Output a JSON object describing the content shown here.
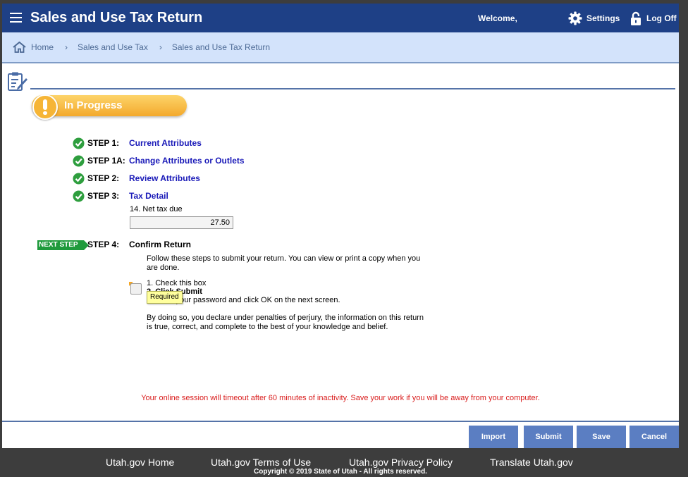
{
  "header": {
    "title": "Sales and Use Tax Return",
    "welcome": "Welcome,",
    "settings_label": "Settings",
    "logoff_label": "Log Off"
  },
  "breadcrumb": [
    "Home",
    "Sales and Use Tax",
    "Sales and Use Tax Return"
  ],
  "status": "In Progress",
  "steps": [
    {
      "label": "STEP 1:",
      "title": "Current Attributes"
    },
    {
      "label": "STEP 1A:",
      "title": "Change Attributes or Outlets"
    },
    {
      "label": "STEP 2:",
      "title": "Review Attributes"
    },
    {
      "label": "STEP 3:",
      "title": "Tax Detail"
    }
  ],
  "net_tax": {
    "label": "14. Net tax due",
    "value": "27.50"
  },
  "next_step": {
    "badge": "NEXT STEP",
    "label": "STEP 4:",
    "title": "Confirm Return",
    "intro": "Follow these steps to submit your return. You can view or print a copy when you are done.",
    "instruction_1": "1. Check this box",
    "instruction_2": "2. Click Submit",
    "instruction_3": "3. Enter your password and click OK on the next screen.",
    "declaration": "By doing so, you declare under penalties of perjury, the information on this return is true, correct, and complete to the best of your knowledge and belief.",
    "required_tooltip": "Required"
  },
  "timeout_notice": "Your online session will timeout after 60 minutes of inactivity. Save your work if you will be away from your computer.",
  "buttons": {
    "import": "Import",
    "submit": "Submit",
    "save": "Save",
    "cancel": "Cancel"
  },
  "footer": {
    "links": [
      "Utah.gov Home",
      "Utah.gov Terms of Use",
      "Utah.gov Privacy Policy",
      "Translate Utah.gov"
    ],
    "copyright": "Copyright © 2019 State of Utah - All rights reserved."
  },
  "colors": {
    "header_bg": "#1e4086",
    "crumb_bg": "#d3e3fb",
    "button_bg": "#5b7ec2",
    "link": "#1a1ab8",
    "warning": "#d91c1c",
    "status": "#f6b536",
    "next_step": "#1f9a3c"
  }
}
